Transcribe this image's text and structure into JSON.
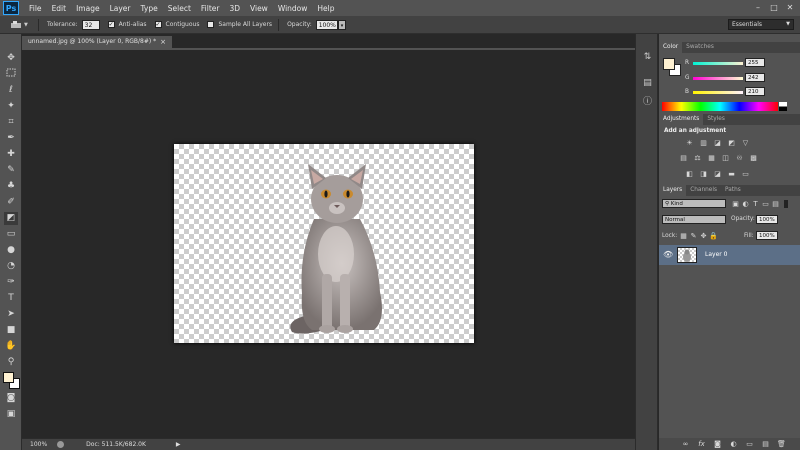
{
  "app": {
    "logo": "Ps"
  },
  "menu": [
    "File",
    "Edit",
    "Image",
    "Layer",
    "Type",
    "Select",
    "Filter",
    "3D",
    "View",
    "Window",
    "Help"
  ],
  "window_controls": {
    "minimize": "–",
    "maximize": "□",
    "close": "✕"
  },
  "options": {
    "tolerance_label": "Tolerance:",
    "tolerance_value": "32",
    "anti_alias": "Anti-alias",
    "contiguous": "Contiguous",
    "sample_all_layers": "Sample All Layers",
    "opacity_label": "Opacity:",
    "opacity_value": "100%",
    "check": "✓",
    "workspace": "Essentials"
  },
  "document": {
    "tab_title": "unnamed.jpg @ 100% (Layer 0, RGB/8#) *",
    "close": "×"
  },
  "status": {
    "zoom": "100%",
    "doc_size": "Doc: 511.5K/682.0K",
    "arrow": "▶"
  },
  "color_panel": {
    "tabs": [
      "Color",
      "Swatches"
    ],
    "r_label": "R",
    "g_label": "G",
    "b_label": "B",
    "r": 255,
    "g": 242,
    "b": 210,
    "foreground": "#fff2d2",
    "background": "#ffffff"
  },
  "adjustments": {
    "tabs": [
      "Adjustments",
      "Styles"
    ],
    "title": "Add an adjustment",
    "row1": [
      "☀",
      "▥",
      "◪",
      "◩",
      "▽"
    ],
    "row2": [
      "▤",
      "⚖",
      "▦",
      "◫",
      "♾",
      "▩"
    ],
    "row3": [
      "◧",
      "◨",
      "◪",
      "▬",
      "▭"
    ]
  },
  "layers": {
    "tabs": [
      "Layers",
      "Channels",
      "Paths"
    ],
    "kind": "Kind",
    "blend_mode": "Normal",
    "opacity_label": "Opacity:",
    "opacity": "100%",
    "lock_label": "Lock:",
    "fill_label": "Fill:",
    "fill": "100%",
    "layer_name": "Layer 0",
    "footer_icons": [
      "∞",
      "fx",
      "◙",
      "◐",
      "▭",
      "▤",
      "🗑"
    ]
  }
}
